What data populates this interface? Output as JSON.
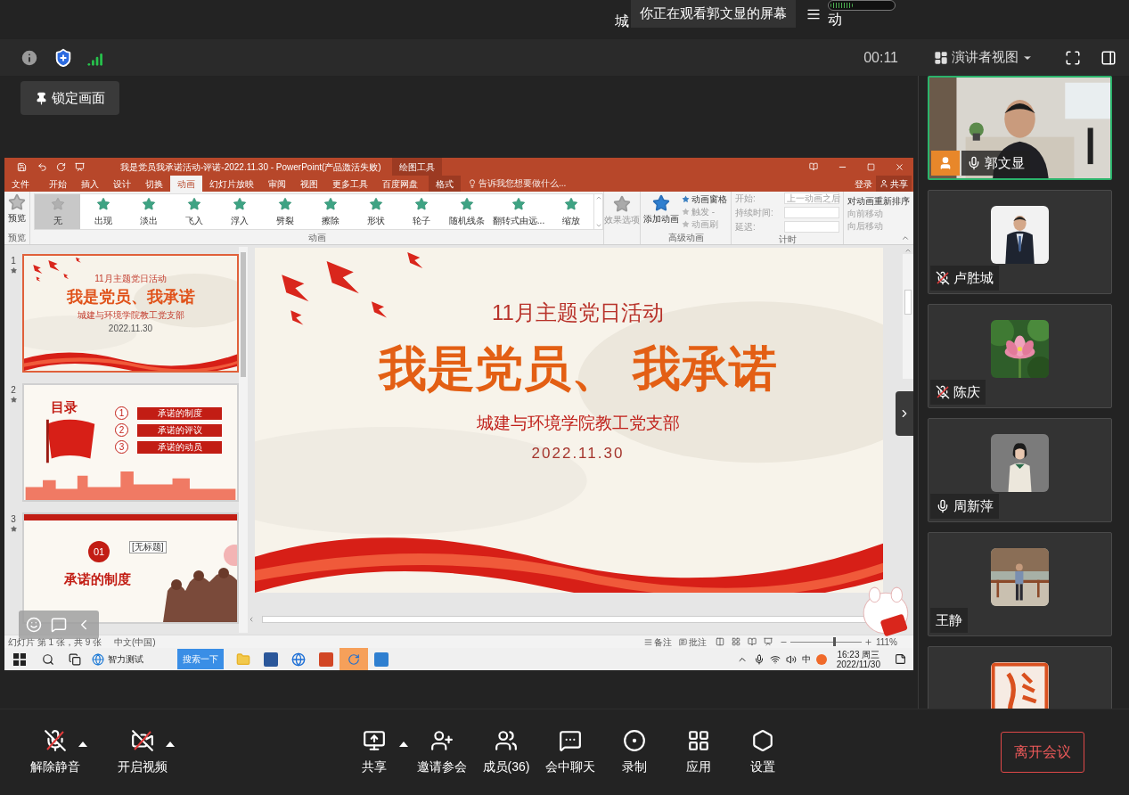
{
  "top_strip": {
    "left_fragment": "城",
    "notice": "你正在观看郭文显的屏幕",
    "right_fragment": "动"
  },
  "meeting_bar": {
    "timer": "00:11",
    "view_mode": "演讲者视图"
  },
  "lock_button": "锁定画面",
  "ppt": {
    "title": "我是党员我承诺活动-评诺-2022.11.30 - PowerPoint(产品激活失败)",
    "context_label": "绘图工具",
    "tabs": [
      {
        "label": "文件",
        "selected": false,
        "kind": "file"
      },
      {
        "label": "开始",
        "selected": false,
        "kind": "tab"
      },
      {
        "label": "插入",
        "selected": false,
        "kind": "tab"
      },
      {
        "label": "设计",
        "selected": false,
        "kind": "tab"
      },
      {
        "label": "切换",
        "selected": false,
        "kind": "tab"
      },
      {
        "label": "动画",
        "selected": true,
        "kind": "tab"
      },
      {
        "label": "幻灯片放映",
        "selected": false,
        "kind": "tab"
      },
      {
        "label": "审阅",
        "selected": false,
        "kind": "tab"
      },
      {
        "label": "视图",
        "selected": false,
        "kind": "tab"
      },
      {
        "label": "更多工具",
        "selected": false,
        "kind": "tab"
      },
      {
        "label": "百度网盘",
        "selected": false,
        "kind": "tab"
      },
      {
        "label": "格式",
        "selected": false,
        "kind": "context"
      }
    ],
    "tell_me": "告诉我您想要做什么...",
    "sign_in": "登录",
    "share": "共享",
    "preview": {
      "label": "预览",
      "group": "预览"
    },
    "animations": [
      {
        "label": "无",
        "selected": true
      },
      {
        "label": "出现",
        "selected": false
      },
      {
        "label": "淡出",
        "selected": false
      },
      {
        "label": "飞入",
        "selected": false
      },
      {
        "label": "浮入",
        "selected": false
      },
      {
        "label": "劈裂",
        "selected": false
      },
      {
        "label": "擦除",
        "selected": false
      },
      {
        "label": "形状",
        "selected": false
      },
      {
        "label": "轮子",
        "selected": false
      },
      {
        "label": "随机线条",
        "selected": false
      },
      {
        "label": "翻转式由远...",
        "selected": false
      },
      {
        "label": "缩放",
        "selected": false
      }
    ],
    "animations_group": "动画",
    "effect_options": "效果选项",
    "add_animation": "添加动画",
    "advanced": [
      {
        "label": "动画窗格",
        "disabled": false
      },
      {
        "label": "触发 -",
        "disabled": true
      },
      {
        "label": "动画刷",
        "disabled": true
      }
    ],
    "advanced_group": "高级动画",
    "timing": [
      {
        "label": "开始:",
        "value": "上一动画之后"
      },
      {
        "label": "持续时间:"
      },
      {
        "label": "延迟:"
      }
    ],
    "timing_group": "计时",
    "reorder": {
      "title": "对动画重新排序",
      "items": [
        "向前移动",
        "向后移动"
      ]
    },
    "thumbnails": [
      {
        "number": "1",
        "kind": "title",
        "selected": true,
        "subtitle": "11月主题党日活动",
        "title": "我是党员、我承诺",
        "org": "城建与环境学院教工党支部",
        "date": "2022.11.30"
      },
      {
        "number": "2",
        "kind": "contents",
        "selected": false,
        "title": "目录",
        "items": [
          {
            "number": "1",
            "label": "承诺的制度"
          },
          {
            "number": "2",
            "label": "承诺的评议"
          },
          {
            "number": "3",
            "label": "承诺的动员"
          }
        ]
      },
      {
        "number": "3",
        "kind": "section",
        "selected": false,
        "badge": "01",
        "title": "承诺的制度"
      }
    ],
    "tooltip": "[无标题]",
    "slide": {
      "subtitle": "11月主题党日活动",
      "title": "我是党员、 我承诺",
      "org": "城建与环境学院教工党支部",
      "date": "2022.11.30"
    },
    "status": {
      "slide_count": "幻灯片 第 1 张，共 9 张",
      "language": "中文(中国)",
      "notes": "备注",
      "comments": "批注",
      "zoom": "111%",
      "level": 0.6
    }
  },
  "taskbar": {
    "browser_label": "智力测试",
    "search_button": "搜索一下",
    "ime": "中",
    "time": "16:23 周三",
    "date": "2022/11/30"
  },
  "participants": [
    {
      "name": "郭文显",
      "kind": "video",
      "mic_shown": true,
      "muted": false,
      "active": true,
      "host": true
    },
    {
      "name": "卢胜城",
      "kind": "avatar",
      "mic_shown": true,
      "muted": true,
      "active": false,
      "host": false
    },
    {
      "name": "陈庆",
      "kind": "avatar",
      "mic_shown": true,
      "muted": true,
      "active": false,
      "host": false
    },
    {
      "name": "周新萍",
      "kind": "avatar",
      "mic_shown": true,
      "muted": false,
      "active": false,
      "host": false
    },
    {
      "name": "王静",
      "kind": "avatar",
      "mic_shown": false,
      "active": false,
      "host": false
    },
    {
      "kind": "avatar",
      "mic_shown": false,
      "active": false,
      "host": false
    }
  ],
  "left_controls": [
    {
      "kind": "mic",
      "label": "解除静音",
      "off": true,
      "menu": true
    },
    {
      "kind": "camera",
      "label": "开启视频",
      "off": true,
      "menu": true
    }
  ],
  "center_controls": [
    {
      "kind": "share",
      "label": "共享",
      "menu": true
    },
    {
      "kind": "invite",
      "label": "邀请参会",
      "menu": false
    },
    {
      "kind": "members",
      "label": "成员(36)",
      "menu": false
    },
    {
      "kind": "chat",
      "label": "会中聊天",
      "menu": false
    },
    {
      "kind": "record",
      "label": "录制",
      "menu": false
    },
    {
      "kind": "apps",
      "label": "应用",
      "menu": false
    },
    {
      "kind": "settings",
      "label": "设置",
      "menu": false
    }
  ],
  "leave_button": "离开会议"
}
